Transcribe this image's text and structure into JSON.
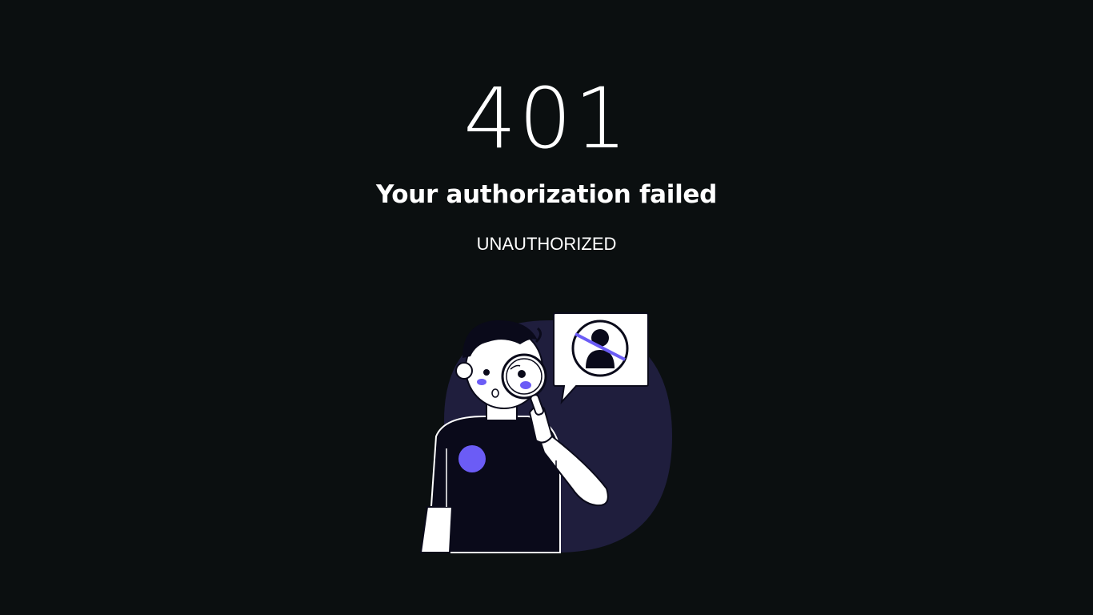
{
  "error": {
    "code": "401",
    "title": "Your authorization failed",
    "status": "UNAUTHORIZED"
  },
  "colors": {
    "background": "#0b0f10",
    "text": "#ffffff",
    "accent": "#6b5cf6",
    "circle": "#1f1e3d",
    "shirt": "#0a0a1a"
  },
  "illustration": {
    "icons": [
      "person-with-magnifier-illustration",
      "blocked-user-icon",
      "magnifying-glass-icon"
    ]
  }
}
